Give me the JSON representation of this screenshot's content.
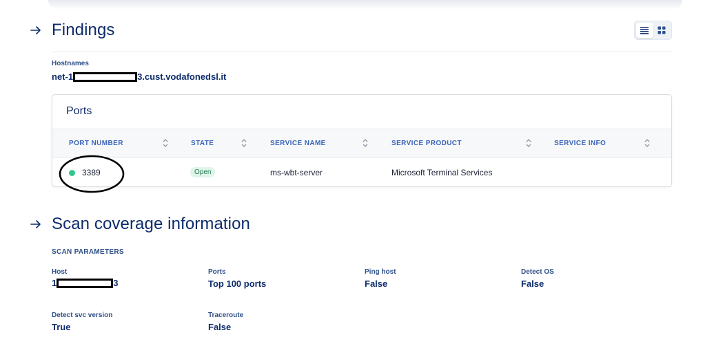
{
  "findings": {
    "title": "Findings",
    "hostnames_label": "Hostnames",
    "hostname_prefix": "net-1",
    "hostname_suffix": "3.cust.vodafonedsl.it"
  },
  "ports": {
    "title": "Ports",
    "columns": [
      "PORT NUMBER",
      "STATE",
      "SERVICE NAME",
      "SERVICE PRODUCT",
      "SERVICE INFO"
    ],
    "rows": [
      {
        "port": "3389",
        "state": "Open",
        "service_name": "ms-wbt-server",
        "service_product": "Microsoft Terminal Services",
        "service_info": ""
      }
    ],
    "status_color": "#2dc98a"
  },
  "scan": {
    "title": "Scan coverage information",
    "params_label": "SCAN PARAMETERS",
    "host": {
      "label": "Host",
      "prefix": "1",
      "suffix": "3"
    },
    "ports": {
      "label": "Ports",
      "value": "Top 100 ports"
    },
    "ping": {
      "label": "Ping host",
      "value": "False"
    },
    "os": {
      "label": "Detect OS",
      "value": "False"
    },
    "svc": {
      "label": "Detect svc version",
      "value": "True"
    },
    "traceroute": {
      "label": "Traceroute",
      "value": "False"
    }
  },
  "view_toggle": {
    "options": [
      "list-view-icon",
      "grid-view-icon"
    ],
    "active": "list-view-icon"
  },
  "colors": {
    "accent": "#0d2b6b",
    "header_text": "#3a64b8",
    "badge_bg": "#dff5e9"
  }
}
